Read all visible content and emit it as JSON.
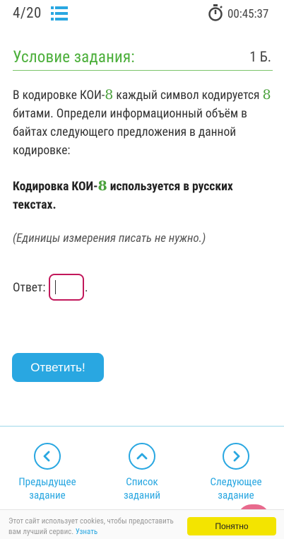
{
  "header": {
    "counter": "4/20",
    "timer": "00:45:37",
    "list_icon": "list-icon",
    "stopwatch_icon": "stopwatch-icon"
  },
  "task": {
    "title": "Условие задания:",
    "points": "1 Б.",
    "question_part1": "В кодировке КОИ-",
    "question_num1": "8",
    "question_part2": " каждый символ кодируется ",
    "question_num2": "8",
    "question_part3": " битами. Определи информационный объём в байтах следующего предложения в данной кодировке:",
    "sentence_part1": "Кодировка КОИ-",
    "sentence_num": "8",
    "sentence_part2": " используется в русских текстах.",
    "note": "(Единицы измерения писать не нужно.)"
  },
  "answer": {
    "label": "Ответ:",
    "value": "",
    "trailing": "."
  },
  "submit_label": "Ответить!",
  "nav": {
    "prev_line1": "Предыдущее",
    "prev_line2": "задание",
    "list_line1": "Список",
    "list_line2": "заданий",
    "next_line1": "Следующее",
    "next_line2": "задание"
  },
  "cookie": {
    "text": "Этот сайт использует cookies, чтобы предоставить вам лучший сервис.",
    "link": "Узнать",
    "button": "Понятно"
  },
  "colors": {
    "green": "#4caf3b",
    "blue": "#29a7e1",
    "magenta": "#c2185b",
    "yellow": "#f3e400"
  }
}
